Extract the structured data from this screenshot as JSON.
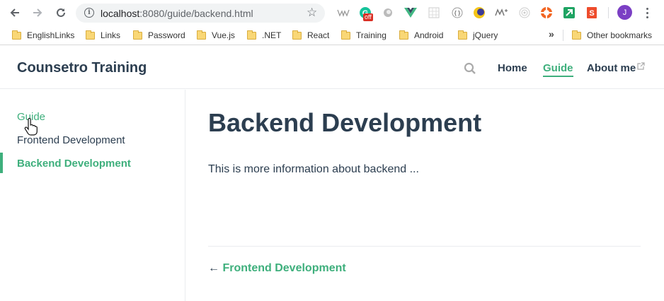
{
  "browser": {
    "url_host": "localhost",
    "url_rest": ":8080/guide/backend.html",
    "extension_badge": "off",
    "avatar_letter": "J",
    "bookmarks": [
      {
        "label": "EnglishLinks"
      },
      {
        "label": "Links"
      },
      {
        "label": "Password"
      },
      {
        "label": "Vue.js"
      },
      {
        "label": ".NET"
      },
      {
        "label": "React"
      },
      {
        "label": "Training"
      },
      {
        "label": "Android"
      },
      {
        "label": "jQuery"
      }
    ],
    "overflow_chevrons": "»",
    "other_bookmarks": "Other bookmarks"
  },
  "site": {
    "title": "Counsetro Training",
    "nav": [
      {
        "label": "Home"
      },
      {
        "label": "Guide"
      },
      {
        "label": "About me"
      }
    ]
  },
  "sidebar": {
    "group": "Guide",
    "items": [
      {
        "label": "Frontend Development"
      },
      {
        "label": "Backend Development"
      }
    ]
  },
  "page": {
    "heading": "Backend Development",
    "body": "This is more information about backend ...",
    "prev_arrow": "←",
    "prev_label": "Frontend Development"
  },
  "colors": {
    "accent": "#3eaf7c",
    "text": "#2c3e50"
  }
}
